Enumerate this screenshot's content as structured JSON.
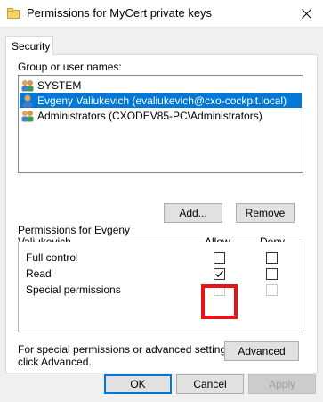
{
  "window": {
    "title": "Permissions for MyCert private keys",
    "close_icon": "close-icon"
  },
  "tabs": [
    {
      "label": "Security"
    }
  ],
  "group_label": "Group or user names:",
  "users": [
    {
      "name": "SYSTEM",
      "selected": false
    },
    {
      "name": "Evgeny Valiukevich (evaliukevich@cxo-cockpit.local)",
      "selected": true
    },
    {
      "name": "Administrators (CXODEV85-PC\\Administrators)",
      "selected": false
    }
  ],
  "buttons": {
    "add": "Add...",
    "remove": "Remove",
    "advanced": "Advanced",
    "ok": "OK",
    "cancel": "Cancel",
    "apply": "Apply"
  },
  "permissions_for": {
    "line1": "Permissions for Evgeny",
    "line2": "Valiukevich"
  },
  "columns": {
    "allow": "Allow",
    "deny": "Deny"
  },
  "permissions": [
    {
      "name": "Full control",
      "allow": false,
      "deny": false,
      "allow_disabled": false,
      "deny_disabled": false
    },
    {
      "name": "Read",
      "allow": true,
      "deny": false,
      "allow_disabled": false,
      "deny_disabled": false
    },
    {
      "name": "Special permissions",
      "allow": false,
      "deny": false,
      "allow_disabled": true,
      "deny_disabled": true
    }
  ],
  "advanced_text": {
    "line1": "For special permissions or advanced settings,",
    "line2": "click Advanced."
  },
  "colors": {
    "selection": "#0078d7",
    "highlight": "#e8131a"
  }
}
